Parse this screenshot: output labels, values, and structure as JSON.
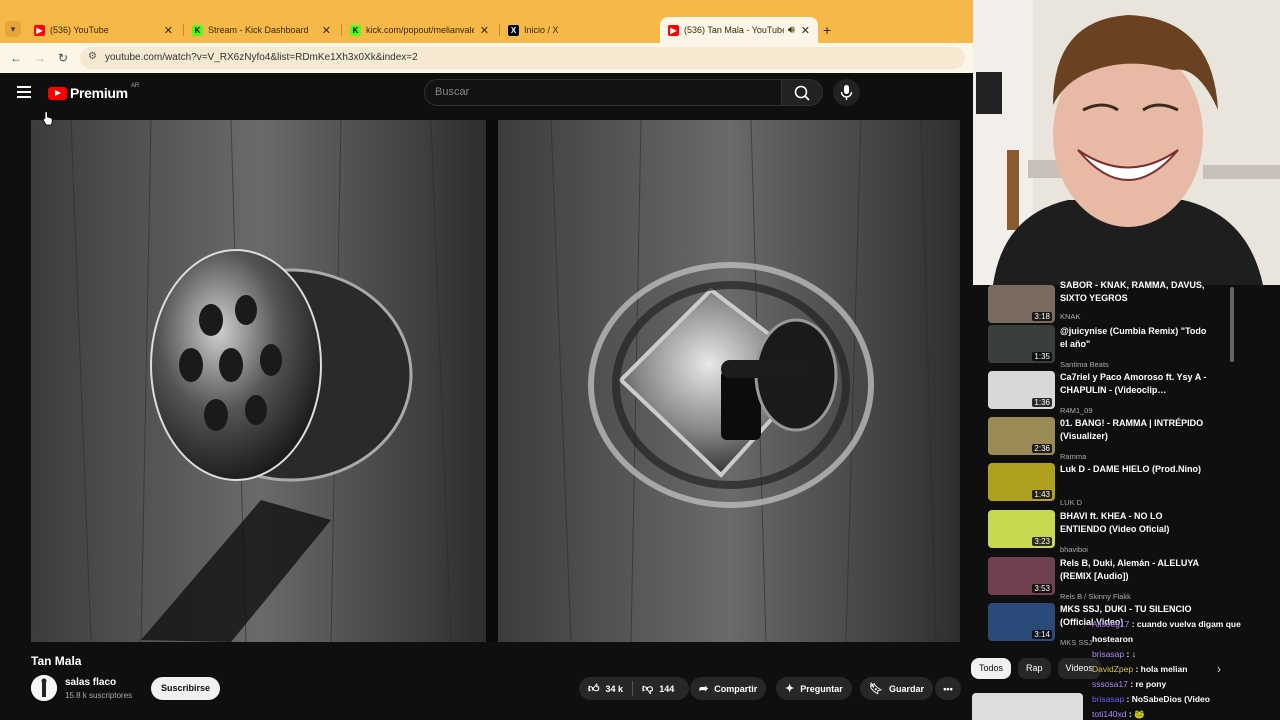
{
  "browser": {
    "tabs": [
      {
        "title": "(536) YouTube",
        "favicon": "youtube-icon",
        "active": false
      },
      {
        "title": "Stream - Kick Dashboard",
        "favicon": "kick-icon",
        "active": false
      },
      {
        "title": "kick.com/popout/melianvalen/",
        "favicon": "kick-icon",
        "active": false
      },
      {
        "title": "Inicio / X",
        "favicon": "x-icon",
        "active": false
      },
      {
        "title": "(536) Tan Mala - YouTube",
        "favicon": "youtube-icon",
        "active": true
      }
    ],
    "url": "youtube.com/watch?v=V_RX6zNyfo4&list=RDmKe1Xh3x0Xk&index=2",
    "accent": "#f7b84a"
  },
  "youtube": {
    "logo_text": "Premium",
    "country": "AR",
    "search_placeholder": "Buscar"
  },
  "video": {
    "title": "Tan Mala",
    "channel": "salas flaco",
    "subscribers": "15.8 k suscriptores",
    "subscribe_label": "Suscribirse",
    "likes": "34 k",
    "dislikes": "144",
    "share_label": "Compartir",
    "ask_label": "Preguntar",
    "save_label": "Guardar"
  },
  "playlist": [
    {
      "title": "SABOR - KNAK, RAMMA, DAVUS, SIXTO YEGROS",
      "channel": "KNAK",
      "duration": "3:18",
      "thumb": "#7a6a60"
    },
    {
      "title": "@juicynise (Cumbia Remix) \"Todo el año\"",
      "channel": "Santima Beats",
      "duration": "1:35",
      "thumb": "#3a3f3c"
    },
    {
      "title": "Ca7riel y Paco Amoroso ft. Ysy A - CHAPULIN - (Videoclip…",
      "channel": "R4M1_09",
      "duration": "1:36",
      "thumb": "#d8d8d8"
    },
    {
      "title": "01. BANG! - RAMMA | INTRÉPIDO (Visualizer)",
      "channel": "Ramma",
      "duration": "2:36",
      "thumb": "#9a8a55"
    },
    {
      "title": "Luk D - DAME HIELO (Prod.Nino)",
      "channel": "LUK D",
      "duration": "1:43",
      "thumb": "#b0a020"
    },
    {
      "title": "BHAVI ft. KHEA - NO LO ENTIENDO (Video Oficial)",
      "channel": "bhaviboi",
      "duration": "3:23",
      "thumb": "#c8d850"
    },
    {
      "title": "Rels B, Duki, Alemán - ALELUYA (REMIX [Audio])",
      "channel": "Rels B / Skinny Flakk",
      "duration": "3:53",
      "thumb": "#704050"
    },
    {
      "title": "MKS SSJ, DUKI - TU SILENCIO (Official Video)",
      "channel": "MKS SSJ",
      "duration": "3:14",
      "thumb": "#2a4a7a"
    }
  ],
  "chips": [
    "Todos",
    "Rap",
    "Videos"
  ],
  "chat": [
    {
      "user": "Alisoeg17",
      "text": ": cuando vuelva digam que hostearon"
    },
    {
      "user": "brisasap",
      "text": ": ↓"
    },
    {
      "user": "DavidZpep",
      "text": ": hola melian"
    },
    {
      "user": "sssosa17",
      "text": ": re pony"
    },
    {
      "user": "brisasap",
      "text": ": NoSabeDios (Video"
    },
    {
      "user": "toti140xd",
      "text": ": 🐸"
    }
  ]
}
